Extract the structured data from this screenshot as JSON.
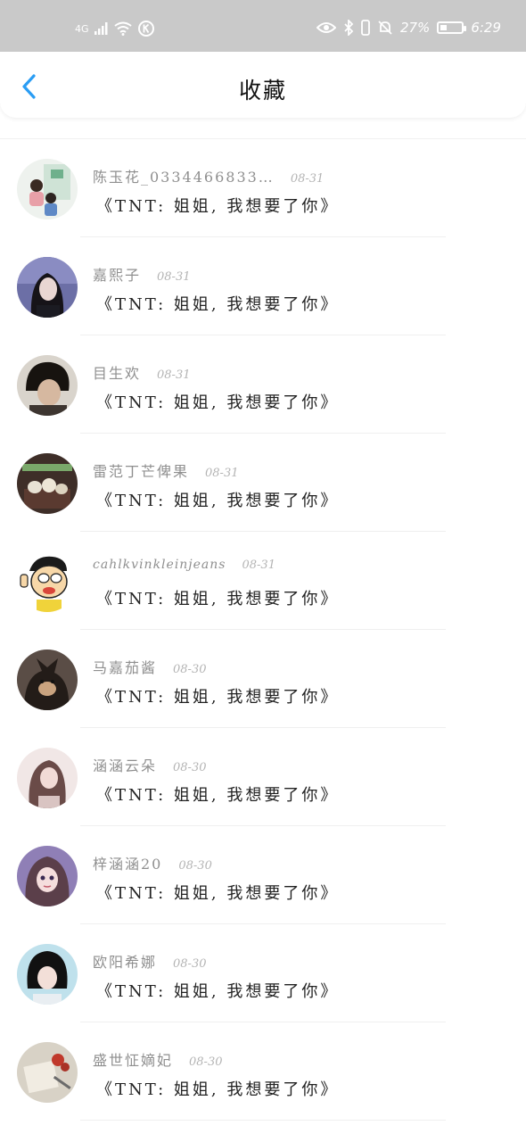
{
  "status_bar": {
    "network": "4G",
    "battery": "27%",
    "time": "6:29"
  },
  "header": {
    "title": "收藏"
  },
  "colors": {
    "accent": "#2a9df4",
    "status_bar": "#c9c9c9"
  },
  "items": [
    {
      "user": "陈玉花_0334466833…",
      "date": "08-31",
      "content": "《TNT: 姐姐, 我想要了你》",
      "avatar": "photo-kids-icon"
    },
    {
      "user": "嘉熙子",
      "date": "08-31",
      "content": "《TNT: 姐姐, 我想要了你》",
      "avatar": "photo-woman-icon"
    },
    {
      "user": "目生欢",
      "date": "08-31",
      "content": "《TNT: 姐姐, 我想要了你》",
      "avatar": "photo-man-icon"
    },
    {
      "user": "雷范丁芒俾果",
      "date": "08-31",
      "content": "《TNT: 姐姐, 我想要了你》",
      "avatar": "photo-objects-icon"
    },
    {
      "user": "cahlkvinkleinjeans",
      "date": "08-31",
      "content": "《TNT: 姐姐, 我想要了你》",
      "avatar": "cartoon-face-icon"
    },
    {
      "user": "马嘉茄酱",
      "date": "08-30",
      "content": "《TNT: 姐姐, 我想要了你》",
      "avatar": "photo-dog-icon"
    },
    {
      "user": "涵涵云朵",
      "date": "08-30",
      "content": "《TNT: 姐姐, 我想要了你》",
      "avatar": "photo-girl-icon"
    },
    {
      "user": "梓涵涵20",
      "date": "08-30",
      "content": "《TNT: 姐姐, 我想要了你》",
      "avatar": "anime-girl-icon"
    },
    {
      "user": "欧阳希娜",
      "date": "08-30",
      "content": "《TNT: 姐姐, 我想要了你》",
      "avatar": "photo-portrait-icon"
    },
    {
      "user": "盛世怔嫡妃",
      "date": "08-30",
      "content": "《TNT: 姐姐, 我想要了你》",
      "avatar": "photo-book-icon"
    }
  ]
}
